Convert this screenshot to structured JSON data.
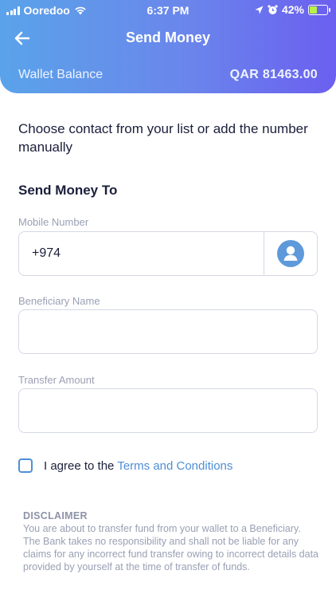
{
  "status_bar": {
    "carrier": "Ooredoo",
    "time": "6:37 PM",
    "battery": "42%",
    "battery_level": 0.42
  },
  "header": {
    "title": "Send Money",
    "wallet_label": "Wallet Balance",
    "wallet_value": "QAR 81463.00"
  },
  "intro_text": "Choose contact from your list or add the number manually",
  "section_title": "Send Money To",
  "form": {
    "mobile_label": "Mobile Number",
    "mobile_value": "+974",
    "beneficiary_label": "Beneficiary Name",
    "beneficiary_value": "",
    "amount_label": "Transfer Amount",
    "amount_value": ""
  },
  "agreement": {
    "text": "I agree to the",
    "link": "Terms and Conditions",
    "checked": false
  },
  "disclaimer": {
    "title": "DISCLAIMER",
    "text": "You are about to transfer fund from your wallet to a Beneficiary. The Bank takes no responsibility and shall not be liable for any claims for any incorrect fund transfer owing to incorrect details data provided by yourself at the time of transfer of funds."
  },
  "colors": {
    "accent": "#4f8ed6",
    "gradient_start": "#5aa3ea",
    "gradient_end": "#6b5ff0"
  },
  "icons": [
    "signal-icon",
    "wifi-icon",
    "location-icon",
    "alarm-icon",
    "battery-icon",
    "back-arrow-icon",
    "contact-person-icon"
  ]
}
